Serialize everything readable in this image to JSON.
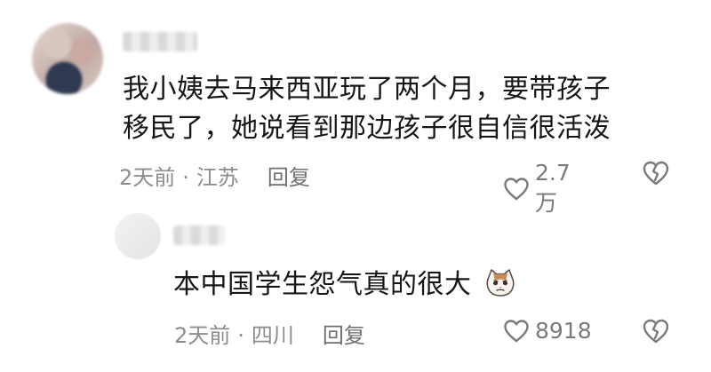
{
  "comments": [
    {
      "text_lines": [
        "我小姨去马来西亚玩了两个月，要带孩子",
        "移民了，她说看到那边孩子很自信很活泼"
      ],
      "time": "2天前",
      "location": "江苏",
      "reply_label": "回复",
      "likes": "2.7万"
    },
    {
      "text": "本中国学生怨气真的很大",
      "emoji": "cat-face-icon",
      "time": "2天前",
      "location": "四川",
      "reply_label": "回复",
      "likes": "8918"
    }
  ],
  "colors": {
    "meta": "#8c8c8c",
    "text": "#161616",
    "icon": "#7a7a7a"
  }
}
